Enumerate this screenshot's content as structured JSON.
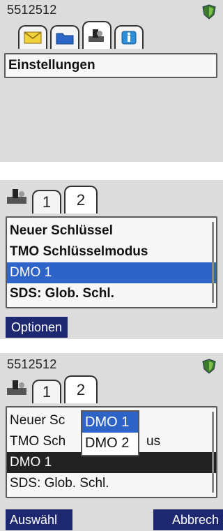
{
  "screen1": {
    "status_number": "5512512",
    "tab_icons": [
      "envelope-icon",
      "folder-icon",
      "settings-icon",
      "info-icon"
    ],
    "menu_item": "Einstellungen"
  },
  "screen2": {
    "tabs": [
      "1",
      "2"
    ],
    "items": [
      "Neuer Schlüssel",
      "TMO Schlüsselmodus",
      "DMO 1",
      "SDS: Glob. Schl."
    ],
    "selected_index": 2,
    "softkey_left": "Optionen"
  },
  "screen3": {
    "status_number": "5512512",
    "tabs": [
      "1",
      "2"
    ],
    "items": [
      "Neuer Sc",
      "TMO Sch",
      "DMO 1",
      "SDS: Glob. Schl."
    ],
    "item_suffix_visible": "us",
    "popup_options": [
      "DMO 1",
      "DMO 2"
    ],
    "popup_selected": "DMO 1",
    "softkey_left": "Auswähl",
    "softkey_right": "Abbrech"
  },
  "colors": {
    "selection_blue": "#2e63c7",
    "softkey_navy": "#1d2870",
    "panel_gray": "#dcdcdc",
    "tab_active_icon_green": "#3c7a2e"
  }
}
